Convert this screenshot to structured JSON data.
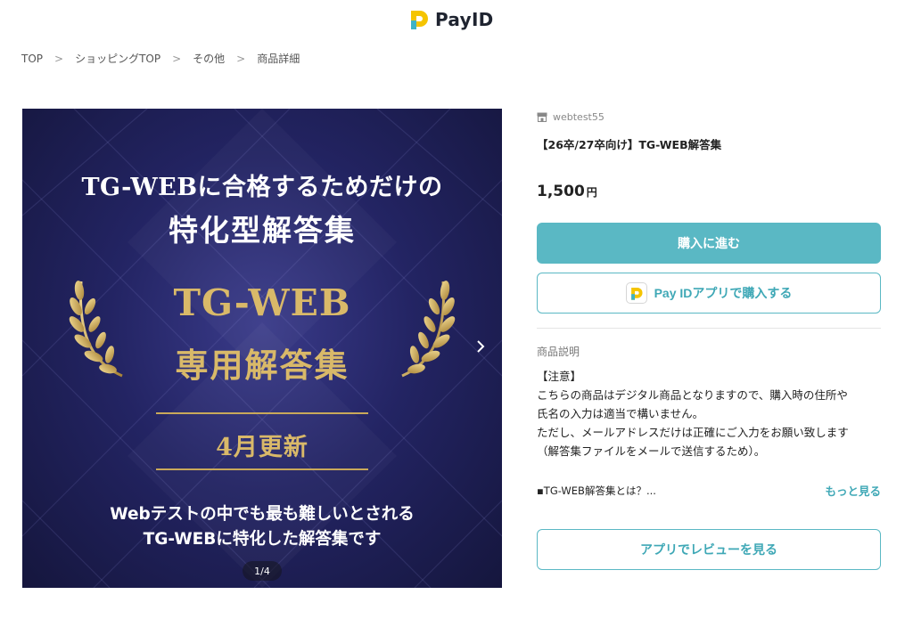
{
  "header": {
    "logo_text": "PayID"
  },
  "breadcrumb": [
    "TOP",
    "ショッピングTOP",
    "その他",
    "商品詳細"
  ],
  "hero": {
    "line1": "TG-WEBに合格するためだけの",
    "line2": "特化型解答集",
    "gold_line1": "TG-WEB",
    "gold_line2": "専用解答集",
    "gold_line3": "4月更新",
    "line3": "Webテストの中でも最も難しいとされる",
    "line4": "TG-WEBに特化した解答集です",
    "pager": "1/4",
    "next_icon": "chevron-right-icon"
  },
  "product": {
    "shop_name": "webtest55",
    "title": "【26卒/27卒向け】TG-WEB解答集",
    "price": "1,500",
    "currency": "円",
    "buy_button": "購入に進む",
    "app_buy_button": "Pay IDアプリで購入する",
    "description_label": "商品説明",
    "description_lines": [
      "【注意】",
      "こちらの商品はデジタル商品となりますので、購入時の住所や",
      "氏名の入力は適当で構いません。",
      "ただし、メールアドレスだけは正確にご入力をお願い致します",
      "（解答集ファイルをメールで送信するため）。"
    ],
    "bullet_preview": "▪TG-WEB解答集とは？...",
    "more_link": "もっと見る",
    "review_button": "アプリでレビューを見る"
  },
  "colors": {
    "accent": "#5ab8c4",
    "gold": "#d9b969",
    "hero_bg": "#232463"
  }
}
